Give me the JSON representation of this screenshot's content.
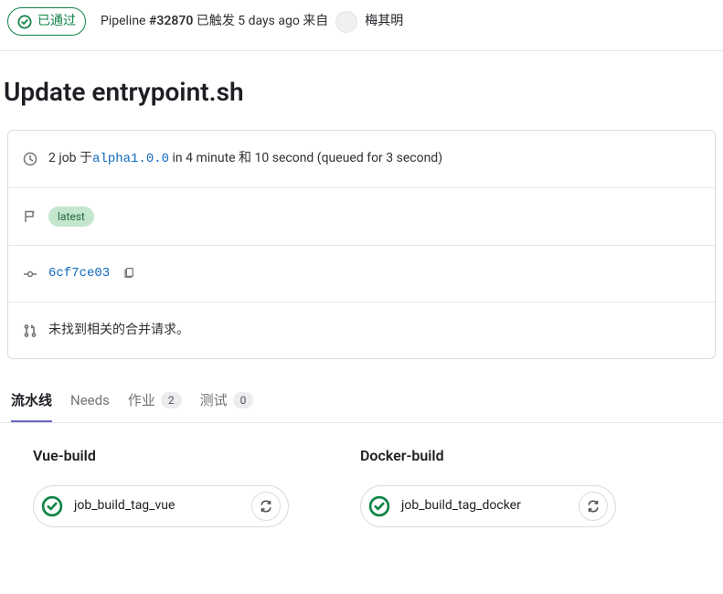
{
  "header": {
    "status_label": "已通过",
    "pipeline_prefix": "Pipeline ",
    "pipeline_id": "#32870",
    "triggered_text": " 已触发 5 days ago 来自 ",
    "username": "梅其明"
  },
  "commit": {
    "title": "Update entrypoint.sh"
  },
  "info": {
    "jobs_prefix": "2 job 于",
    "ref": "alpha1.0.0",
    "duration_text": " in 4 minute 和 10 second (queued for 3 second)",
    "tag": "latest",
    "sha": "6cf7ce03",
    "mr_text": "未找到相关的合并请求。"
  },
  "tabs": {
    "pipeline": "流水线",
    "needs": "Needs",
    "jobs": "作业",
    "jobs_count": "2",
    "tests": "测试",
    "tests_count": "0"
  },
  "stages": [
    {
      "name": "Vue-build",
      "job": "job_build_tag_vue"
    },
    {
      "name": "Docker-build",
      "job": "job_build_tag_docker"
    }
  ]
}
